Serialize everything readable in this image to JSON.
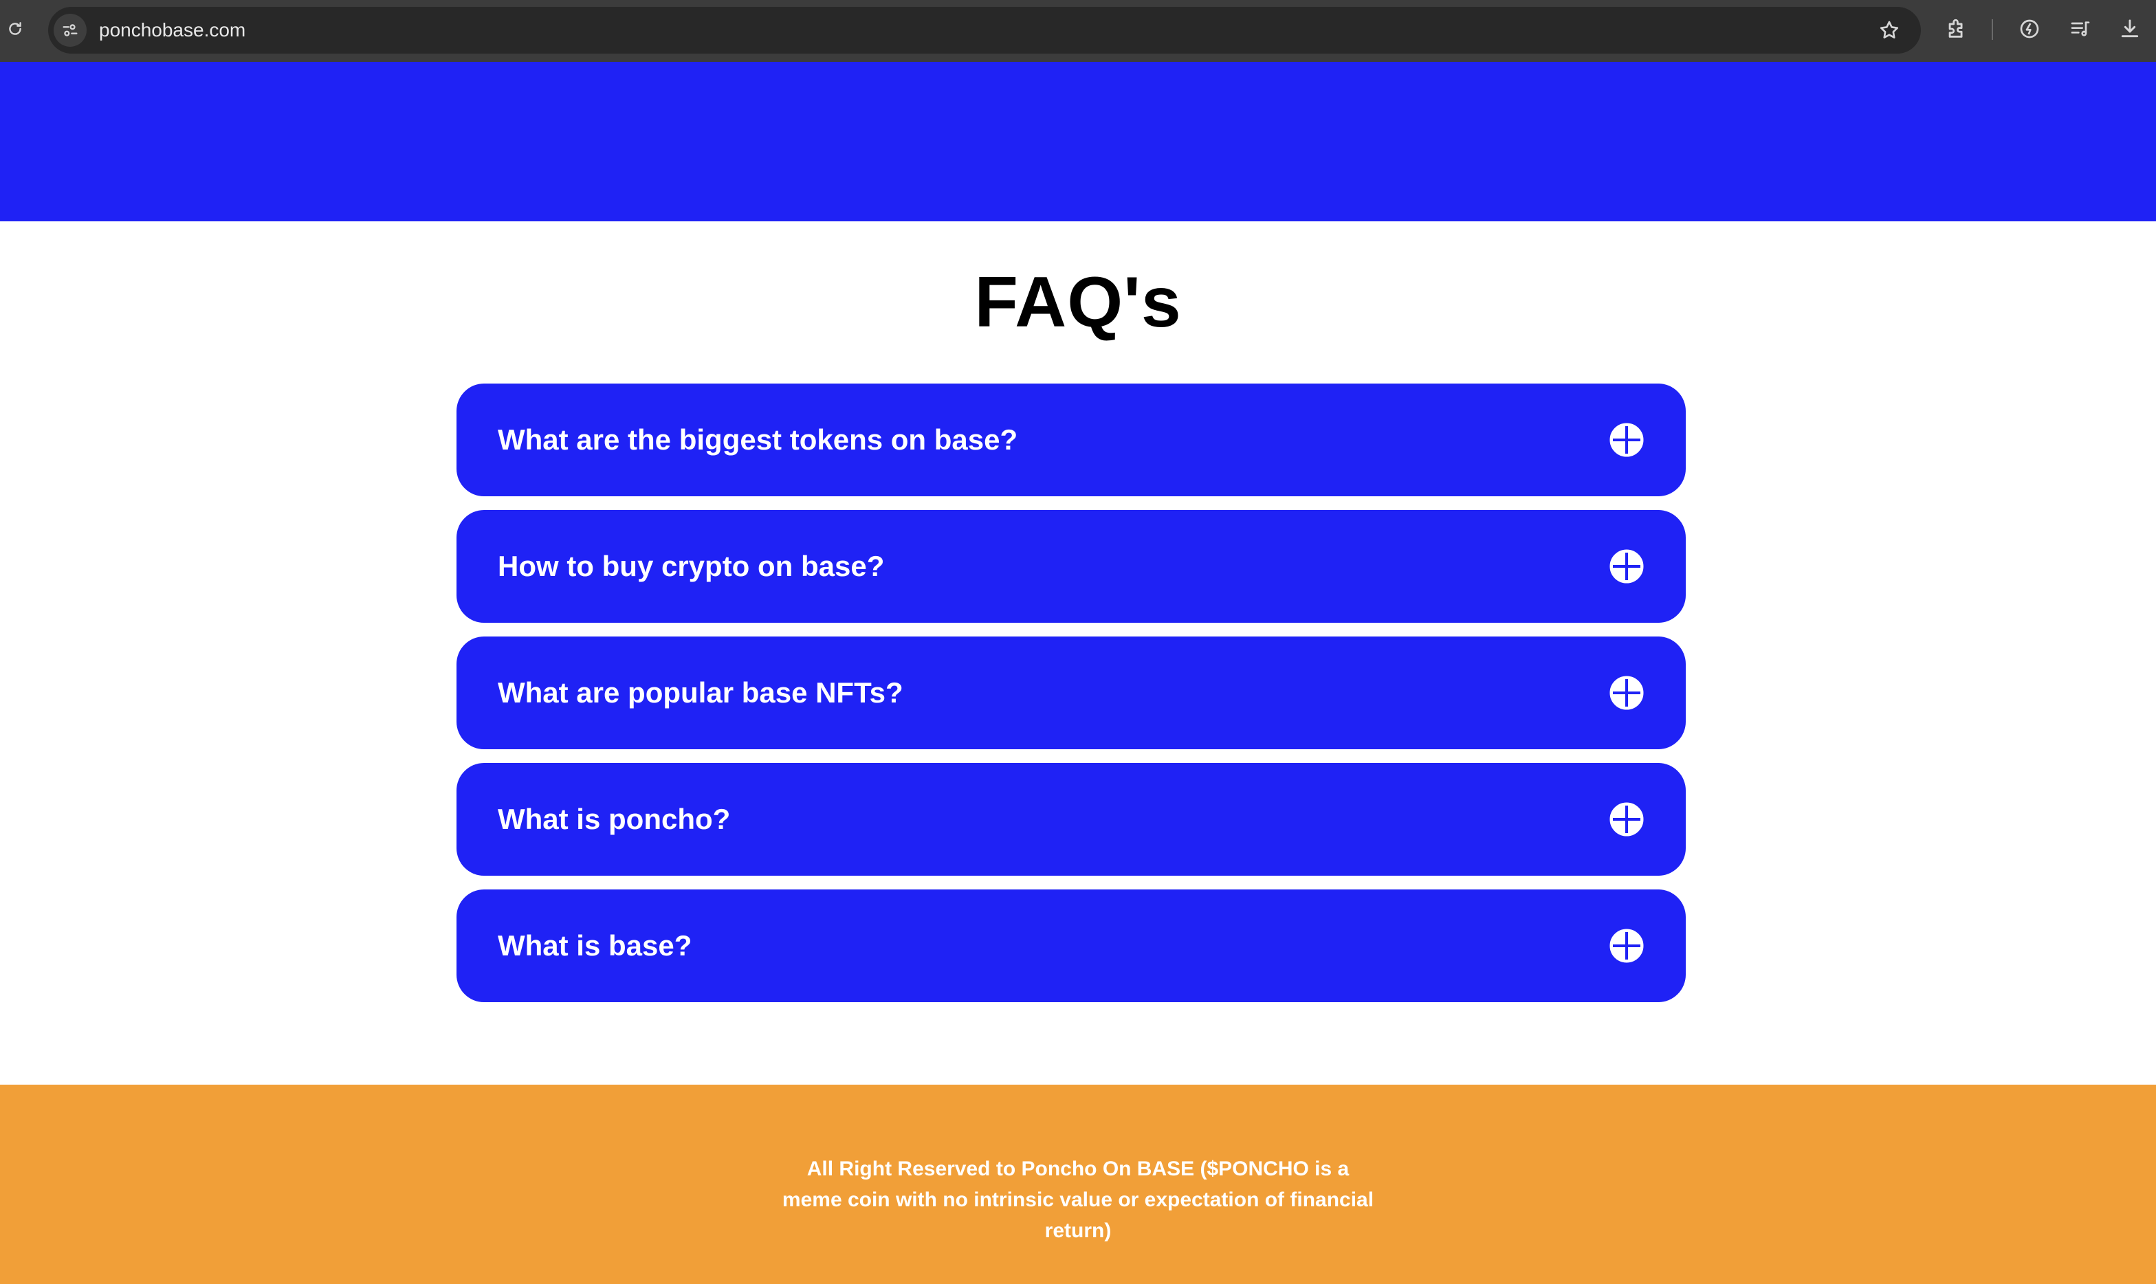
{
  "browser": {
    "url": "ponchobase.com"
  },
  "faq": {
    "title": "FAQ's",
    "items": [
      {
        "question": "What are the biggest tokens on base?"
      },
      {
        "question": "How to buy crypto on base?"
      },
      {
        "question": "What are popular base NFTs?"
      },
      {
        "question": "What is poncho?"
      },
      {
        "question": "What is base?"
      }
    ]
  },
  "footer": {
    "text": "All Right Reserved to Poncho On BASE ($PONCHO is a meme coin with no intrinsic value or expectation of financial return)"
  },
  "colors": {
    "brand_blue": "#1f22f5",
    "footer_orange": "#f19f38",
    "chrome_dark": "#3c3c3c"
  }
}
